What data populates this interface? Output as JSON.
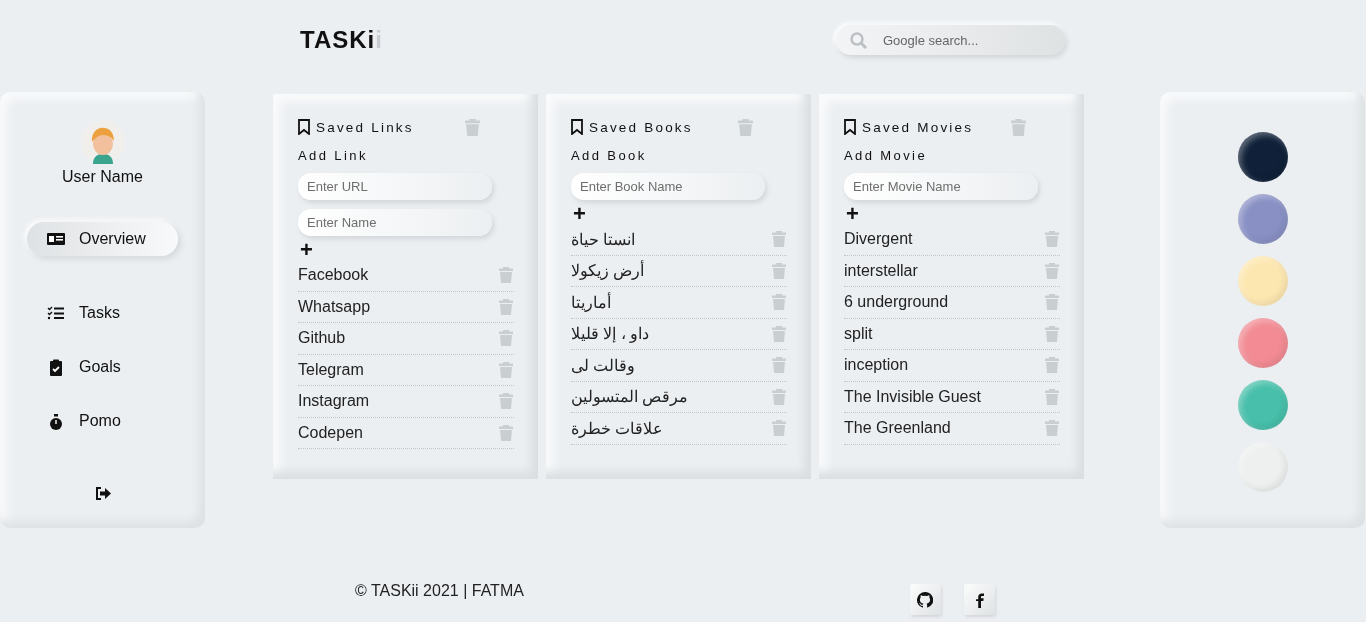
{
  "header": {
    "logo": {
      "main": "TASKi",
      "accent": "i"
    },
    "search": {
      "placeholder": "Google search..."
    }
  },
  "sidebar": {
    "user_name": "User Name",
    "items": [
      {
        "label": "Overview",
        "selected": true
      },
      {
        "label": "Tasks",
        "selected": false
      },
      {
        "label": "Goals",
        "selected": false
      },
      {
        "label": "Pomo",
        "selected": false
      }
    ]
  },
  "cards": [
    {
      "title": "Saved Links",
      "add_label": "Add Link",
      "add_button": "+",
      "inputs": [
        {
          "placeholder": "Enter URL"
        },
        {
          "placeholder": "Enter Name"
        }
      ],
      "items": [
        "Facebook",
        "Whatsapp",
        "Github",
        "Telegram",
        "Instagram",
        "Codepen"
      ]
    },
    {
      "title": "Saved Books",
      "add_label": "Add Book",
      "add_button": "+",
      "inputs": [
        {
          "placeholder": "Enter Book Name"
        }
      ],
      "items": [
        "انستا حياة",
        "أرض زيكولا",
        "أماريتا",
        "داو ، إلا قليلا",
        "وقالت لى",
        "مرقص المتسولين",
        "علاقات خطرة"
      ]
    },
    {
      "title": "Saved Movies",
      "add_label": "Add Movie",
      "add_button": "+",
      "inputs": [
        {
          "placeholder": "Enter Movie Name"
        }
      ],
      "items": [
        "Divergent",
        "interstellar",
        "6 underground",
        "split",
        "inception",
        "The Invisible Guest",
        "The Greenland"
      ]
    }
  ],
  "themes": [
    {
      "color": "#0f2038"
    },
    {
      "color": "#8890c4"
    },
    {
      "color": "#fde7b0"
    },
    {
      "color": "#f28b94"
    },
    {
      "color": "#47bfaa"
    },
    {
      "color": "#eef0f0"
    }
  ],
  "footer": {
    "copyright": "© TASKii 2021 | FATMA"
  }
}
